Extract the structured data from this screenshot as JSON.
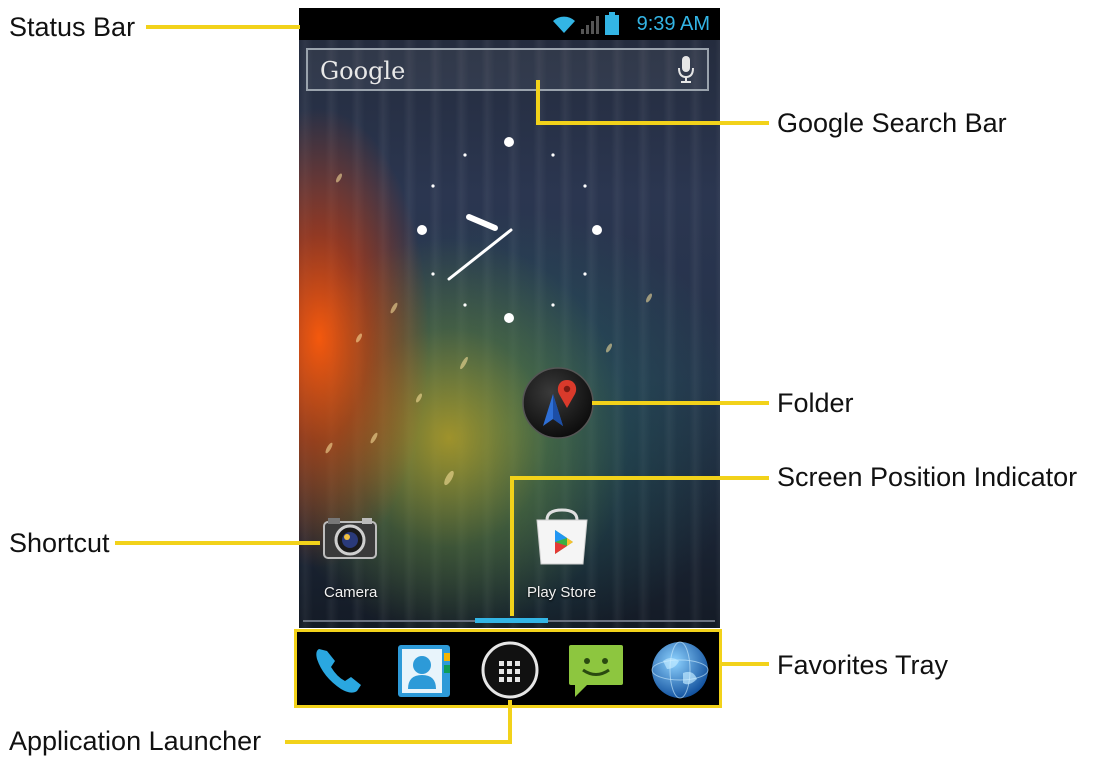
{
  "callouts": {
    "status_bar": "Status Bar",
    "google_search_bar": "Google Search Bar",
    "folder": "Folder",
    "screen_position_indicator": "Screen Position Indicator",
    "shortcut": "Shortcut",
    "favorites_tray": "Favorites Tray",
    "application_launcher": "Application Launcher"
  },
  "status_bar": {
    "time": "9:39 AM",
    "icons": [
      "wifi-icon",
      "signal-icon",
      "battery-icon"
    ]
  },
  "search": {
    "logo_text": "Google",
    "icons": [
      "microphone-icon"
    ]
  },
  "home_screen": {
    "clock": "analog-clock",
    "folder_icon": "maps-navigation-icon",
    "shortcuts": [
      {
        "label": "Camera",
        "icon": "camera-icon"
      },
      {
        "label": "Play Store",
        "icon": "play-store-icon"
      }
    ]
  },
  "favorites_tray": {
    "items": [
      "phone-icon",
      "contacts-icon",
      "app-launcher-icon",
      "messaging-icon",
      "browser-icon"
    ]
  },
  "colors": {
    "callout_line": "#f2d21a",
    "accent": "#33b5e5"
  }
}
